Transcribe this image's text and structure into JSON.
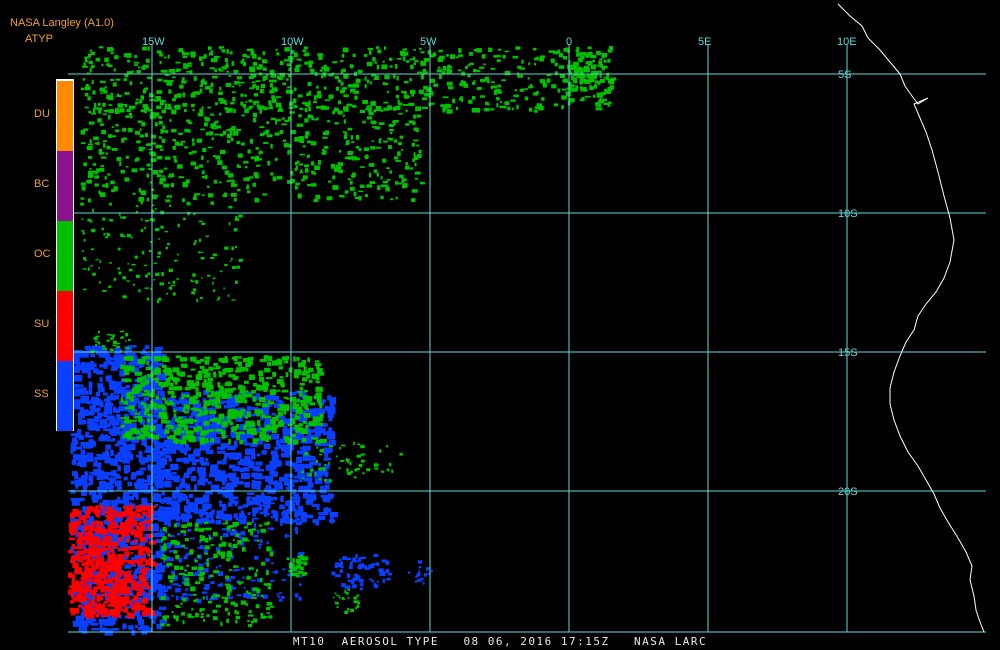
{
  "header": {
    "producer": "NASA Langley (A1.0)",
    "product_code": "ATYP"
  },
  "legend": [
    {
      "code": "DU",
      "color": "#ff8a00"
    },
    {
      "code": "BC",
      "color": "#8b128e"
    },
    {
      "code": "OC",
      "color": "#00c000"
    },
    {
      "code": "SU",
      "color": "#ff0000"
    },
    {
      "code": "SS",
      "color": "#0a3fff"
    }
  ],
  "grid": {
    "color": "#60d8d8",
    "longitudes": [
      {
        "label": "15W",
        "value": -15
      },
      {
        "label": "10W",
        "value": -10
      },
      {
        "label": "5W",
        "value": -5
      },
      {
        "label": "0",
        "value": 0
      },
      {
        "label": "5E",
        "value": 5
      },
      {
        "label": "10E",
        "value": 10
      }
    ],
    "latitudes": [
      {
        "label": "5S",
        "value": -5
      },
      {
        "label": "10S",
        "value": -10
      },
      {
        "label": "15S",
        "value": -15
      },
      {
        "label": "20S",
        "value": -20
      }
    ]
  },
  "footer": {
    "satellite": "MT10",
    "product": "AEROSOL TYPE",
    "date": "08 06, 2016",
    "time": "17:15Z",
    "source": "NASA LARC"
  }
}
